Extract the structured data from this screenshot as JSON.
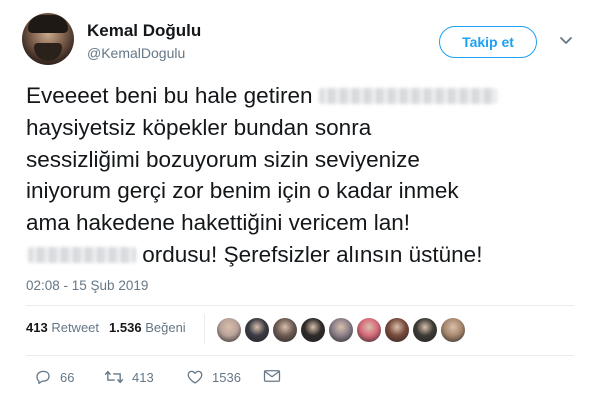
{
  "author": {
    "name": "Kemal Doğulu",
    "handle": "@KemalDogulu"
  },
  "follow_button_label": "Takip et",
  "tweet": {
    "line1": "Eveeeet beni bu hale getiren",
    "line2": "haysiyetsiz köpekler bundan sonra",
    "line3": "sessizliğimi bozuyorum sizin seviyenize",
    "line4": "iniyorum gerçi zor benim için o kadar inmek",
    "line5": "ama hakedene hakettiğini vericem lan!",
    "line6": "ordusu! Şerefsizler alınsın üstüne!"
  },
  "timestamp": "02:08 - 15 Şub 2019",
  "stats": {
    "retweets_count": "413",
    "retweets_label": "Retweet",
    "likes_count": "1.536",
    "likes_label": "Beğeni"
  },
  "likers_avatar_colors": [
    "#b9a29a",
    "#3b3a44",
    "#6d5a52",
    "#2e2a2a",
    "#8b7f88",
    "#d66a7a",
    "#7a4a3c",
    "#3c3a36",
    "#a9886f"
  ],
  "actions": {
    "reply_count": "66",
    "retweet_count": "413",
    "like_count": "1536"
  },
  "colors": {
    "accent": "#1da1f2",
    "text": "#14171a",
    "muted": "#657786"
  }
}
